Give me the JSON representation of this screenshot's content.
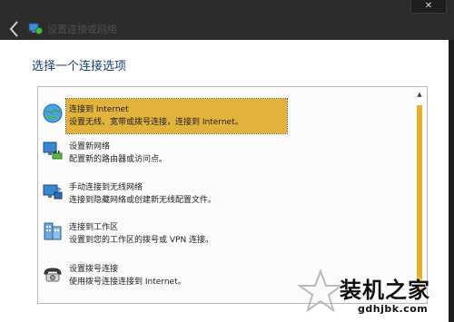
{
  "window": {
    "title": "设置连接或网络",
    "close_label": "✕",
    "back_icon": "back-arrow-icon",
    "app_icon": "network-setup-icon"
  },
  "main": {
    "heading": "选择一个连接选项"
  },
  "options": [
    {
      "title": "连接到 Internet",
      "description": "设置无线、宽带或拨号连接，连接到 Internet。",
      "icon": "globe-internet-icon",
      "selected": true
    },
    {
      "title": "设置新网络",
      "description": "配置新的路由器或访问点。",
      "icon": "new-network-icon",
      "selected": false
    },
    {
      "title": "手动连接到无线网络",
      "description": "连接到隐藏网络或创建新无线配置文件。",
      "icon": "wireless-manual-icon",
      "selected": false
    },
    {
      "title": "连接到工作区",
      "description": "设置到您的工作区的拨号或 VPN 连接。",
      "icon": "workplace-icon",
      "selected": false
    },
    {
      "title": "设置拨号连接",
      "description": "使用拨号连接连接到 Internet。",
      "icon": "dialup-phone-icon",
      "selected": false
    }
  ],
  "scrollbar": {
    "up_arrow": "▲"
  },
  "watermark": {
    "title": "装机之家",
    "url": "gdhjbk.com"
  },
  "colors": {
    "selection": "#e3b23c",
    "heading": "#1c3c70",
    "titlebar": "#2c2c2c"
  }
}
